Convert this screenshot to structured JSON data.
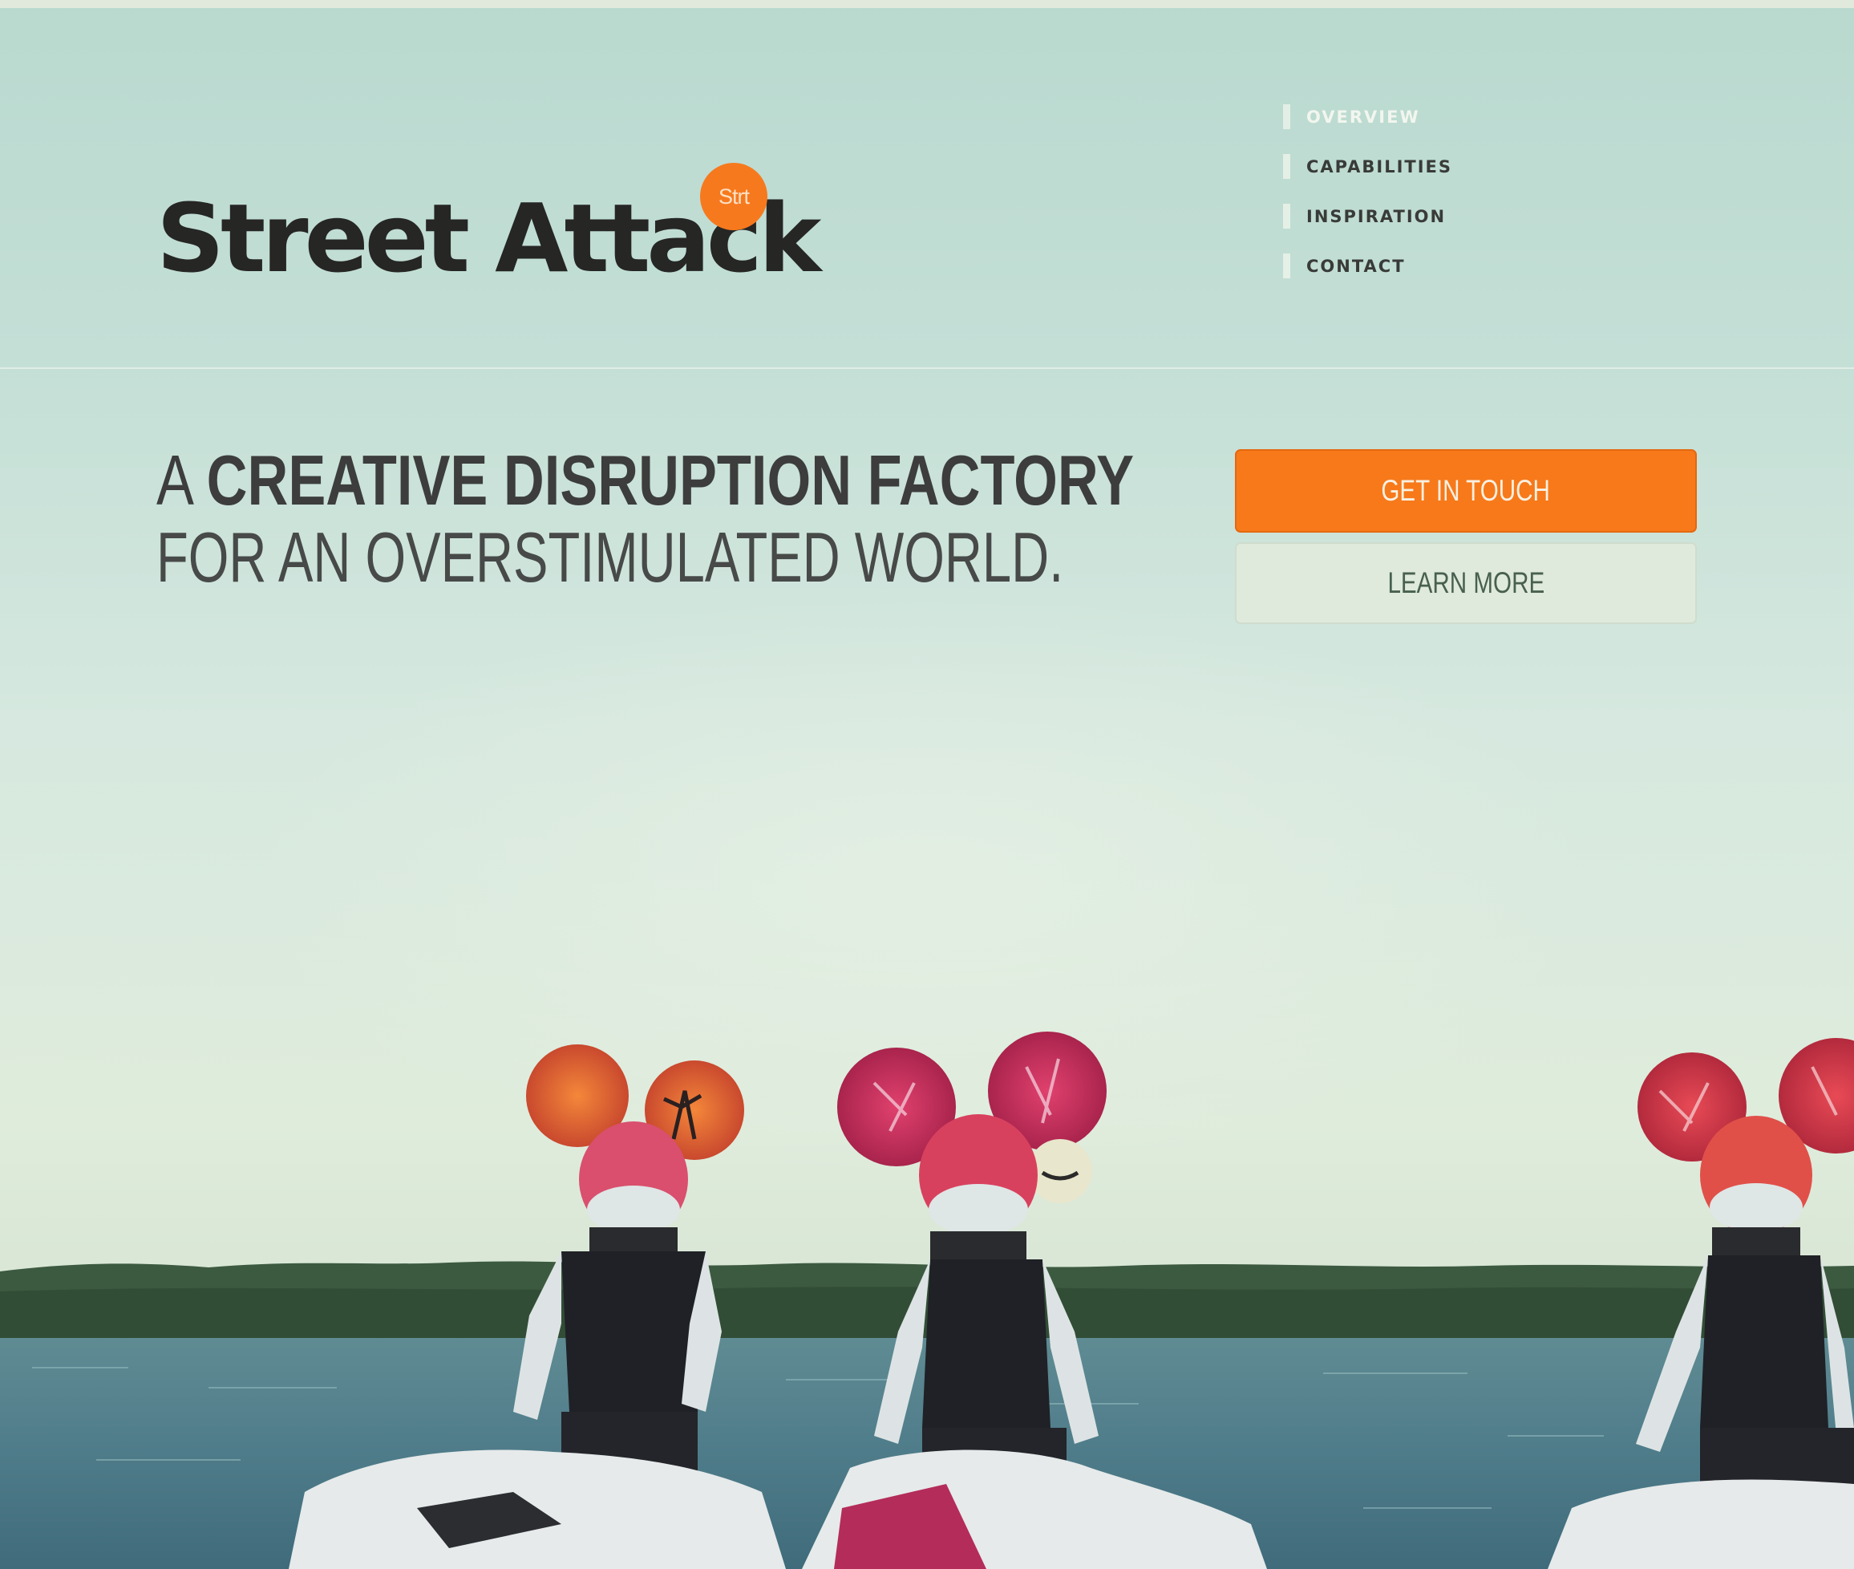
{
  "brand": {
    "name": "Street Attack",
    "badge": "Strt"
  },
  "nav": {
    "items": [
      {
        "label": "OVERVIEW",
        "active": true
      },
      {
        "label": "CAPABILITIES",
        "active": false
      },
      {
        "label": "INSPIRATION",
        "active": false
      },
      {
        "label": "CONTACT",
        "active": false
      }
    ]
  },
  "hero": {
    "line1_prefix": "A",
    "line1_emphasis": "CREATIVE DISRUPTION FACTORY",
    "line2": "FOR AN OVERSTIMULATED WORLD."
  },
  "actions": {
    "primary_label": "GET IN TOUCH",
    "secondary_label": "LEARN MORE"
  },
  "colors": {
    "accent": "#f7791a",
    "text_dark": "#3c3d3c",
    "background": "#c4dfd4"
  }
}
